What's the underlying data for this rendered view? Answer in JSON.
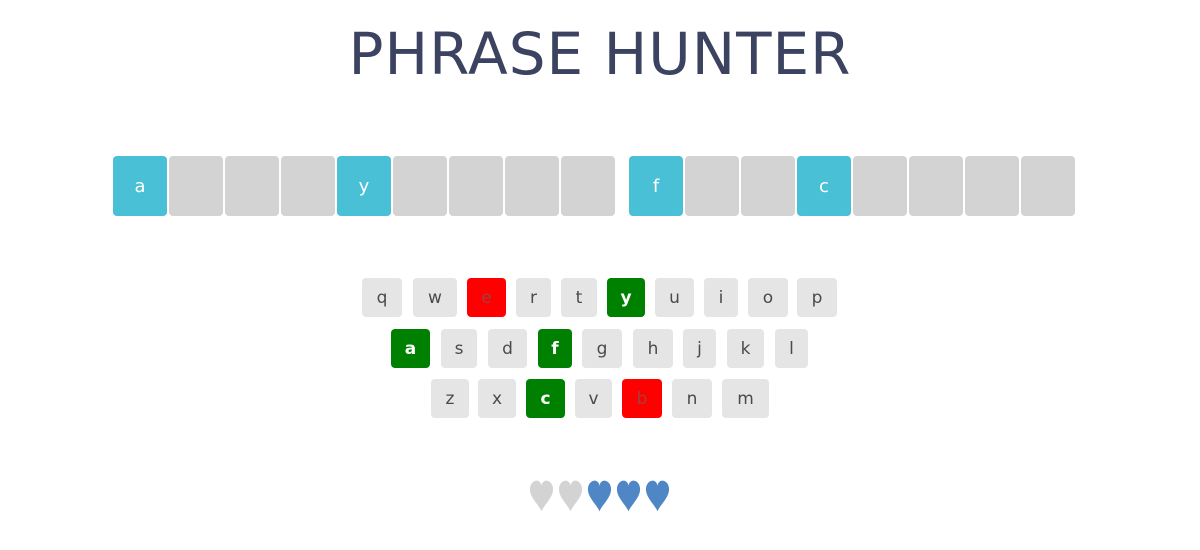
{
  "title": "PHRASE HUNTER",
  "phrase": [
    [
      {
        "letter": "a",
        "revealed": true
      },
      {
        "letter": "",
        "revealed": false
      },
      {
        "letter": "",
        "revealed": false
      },
      {
        "letter": "",
        "revealed": false
      },
      {
        "letter": "y",
        "revealed": true
      },
      {
        "letter": "",
        "revealed": false
      },
      {
        "letter": "",
        "revealed": false
      },
      {
        "letter": "",
        "revealed": false
      },
      {
        "letter": "",
        "revealed": false
      }
    ],
    [
      {
        "letter": "f",
        "revealed": true
      },
      {
        "letter": "",
        "revealed": false
      },
      {
        "letter": "",
        "revealed": false
      },
      {
        "letter": "c",
        "revealed": true
      },
      {
        "letter": "",
        "revealed": false
      },
      {
        "letter": "",
        "revealed": false
      },
      {
        "letter": "",
        "revealed": false
      },
      {
        "letter": "",
        "revealed": false
      }
    ]
  ],
  "keyboard": [
    [
      {
        "key": "q",
        "state": "unused"
      },
      {
        "key": "w",
        "state": "unused"
      },
      {
        "key": "e",
        "state": "wrong"
      },
      {
        "key": "r",
        "state": "unused"
      },
      {
        "key": "t",
        "state": "unused"
      },
      {
        "key": "y",
        "state": "chosen"
      },
      {
        "key": "u",
        "state": "unused"
      },
      {
        "key": "i",
        "state": "unused"
      },
      {
        "key": "o",
        "state": "unused"
      },
      {
        "key": "p",
        "state": "unused"
      }
    ],
    [
      {
        "key": "a",
        "state": "chosen"
      },
      {
        "key": "s",
        "state": "unused"
      },
      {
        "key": "d",
        "state": "unused"
      },
      {
        "key": "f",
        "state": "chosen"
      },
      {
        "key": "g",
        "state": "unused"
      },
      {
        "key": "h",
        "state": "unused"
      },
      {
        "key": "j",
        "state": "unused"
      },
      {
        "key": "k",
        "state": "unused"
      },
      {
        "key": "l",
        "state": "unused"
      }
    ],
    [
      {
        "key": "z",
        "state": "unused"
      },
      {
        "key": "x",
        "state": "unused"
      },
      {
        "key": "c",
        "state": "chosen"
      },
      {
        "key": "v",
        "state": "unused"
      },
      {
        "key": "b",
        "state": "wrong"
      },
      {
        "key": "n",
        "state": "unused"
      },
      {
        "key": "m",
        "state": "unused"
      }
    ]
  ],
  "lives": {
    "total": 5,
    "remaining": 3,
    "lost_icon": "heart-icon-lost",
    "live_icon": "heart-icon-live",
    "lost_color": "#d3d3d3",
    "live_color": "#4f86c6"
  },
  "colors": {
    "title": "#3b4361",
    "tile_hidden": "#d3d3d3",
    "tile_revealed": "#4ac0d6",
    "key_unused": "#e5e5e5",
    "key_chosen": "#008000",
    "key_wrong": "#ff0000"
  }
}
